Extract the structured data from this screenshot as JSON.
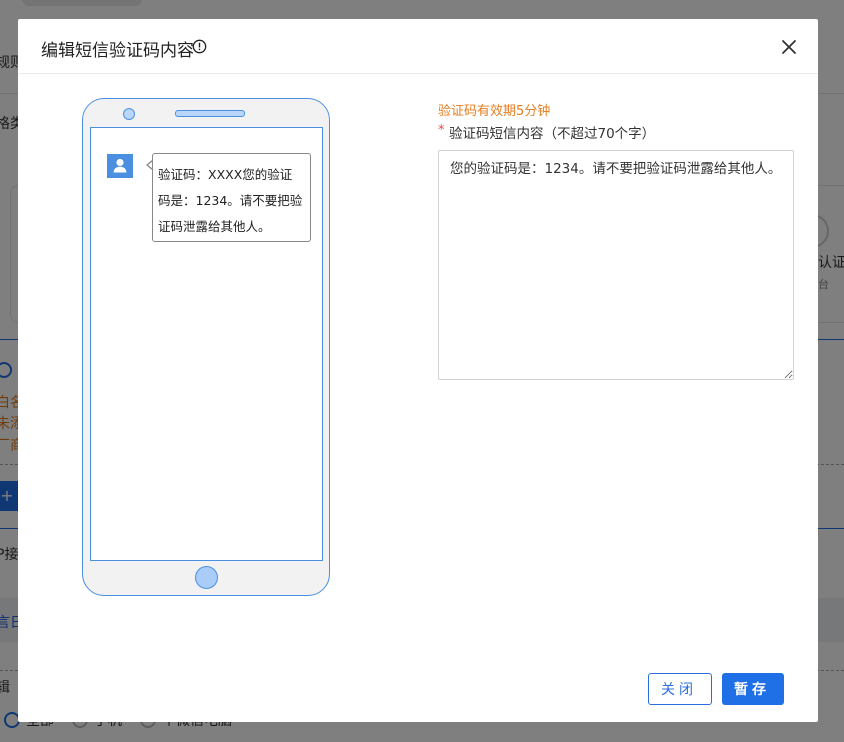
{
  "background": {
    "texts": [
      "规则",
      "格类",
      "认证",
      "台",
      "白名",
      "未添",
      "厂商",
      "P接",
      "言日",
      "辑",
      "全部",
      "手机",
      "个微信电脑"
    ]
  },
  "dialog": {
    "title": "编辑短信验证码内容",
    "close_label": "关闭",
    "save_label": "暂存"
  },
  "preview": {
    "message": "验证码：XXXX您的验证码是：1234。请不要把验证码泄露给其他人。"
  },
  "form": {
    "validity_note": "验证码有效期5分钟",
    "required_mark": "*",
    "content_label": "验证码短信内容（不超过70个字）",
    "content_value": "您的验证码是：1234。请不要把验证码泄露给其他人。"
  },
  "colors": {
    "primary": "#1f6fe6",
    "warning": "#e67e22",
    "required": "#e54b4b",
    "phone_outline": "#4a90e2"
  },
  "icons": {
    "title_info": "info-circle-icon",
    "close": "close-icon",
    "avatar": "user-avatar-icon"
  }
}
